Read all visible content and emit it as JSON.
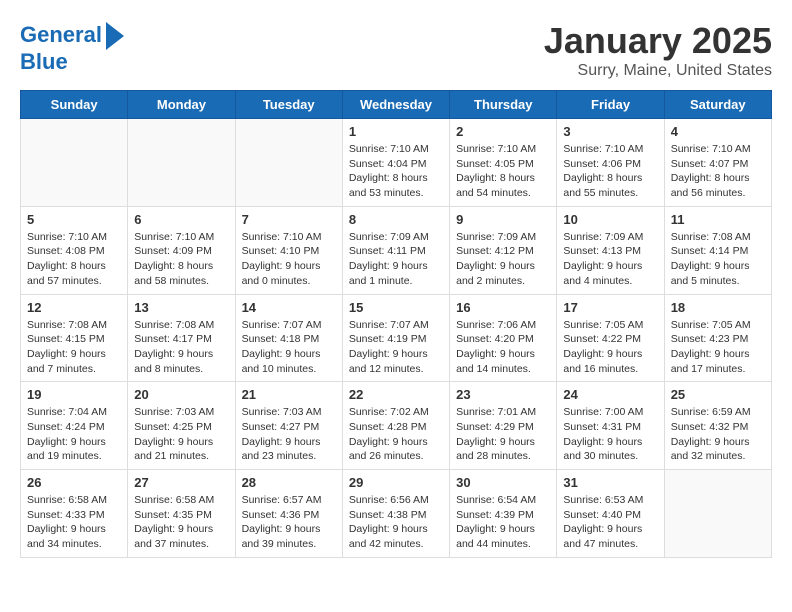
{
  "logo": {
    "line1": "General",
    "line2": "Blue"
  },
  "title": "January 2025",
  "subtitle": "Surry, Maine, United States",
  "weekdays": [
    "Sunday",
    "Monday",
    "Tuesday",
    "Wednesday",
    "Thursday",
    "Friday",
    "Saturday"
  ],
  "weeks": [
    [
      {
        "day": "",
        "detail": ""
      },
      {
        "day": "",
        "detail": ""
      },
      {
        "day": "",
        "detail": ""
      },
      {
        "day": "1",
        "detail": "Sunrise: 7:10 AM\nSunset: 4:04 PM\nDaylight: 8 hours\nand 53 minutes."
      },
      {
        "day": "2",
        "detail": "Sunrise: 7:10 AM\nSunset: 4:05 PM\nDaylight: 8 hours\nand 54 minutes."
      },
      {
        "day": "3",
        "detail": "Sunrise: 7:10 AM\nSunset: 4:06 PM\nDaylight: 8 hours\nand 55 minutes."
      },
      {
        "day": "4",
        "detail": "Sunrise: 7:10 AM\nSunset: 4:07 PM\nDaylight: 8 hours\nand 56 minutes."
      }
    ],
    [
      {
        "day": "5",
        "detail": "Sunrise: 7:10 AM\nSunset: 4:08 PM\nDaylight: 8 hours\nand 57 minutes."
      },
      {
        "day": "6",
        "detail": "Sunrise: 7:10 AM\nSunset: 4:09 PM\nDaylight: 8 hours\nand 58 minutes."
      },
      {
        "day": "7",
        "detail": "Sunrise: 7:10 AM\nSunset: 4:10 PM\nDaylight: 9 hours\nand 0 minutes."
      },
      {
        "day": "8",
        "detail": "Sunrise: 7:09 AM\nSunset: 4:11 PM\nDaylight: 9 hours\nand 1 minute."
      },
      {
        "day": "9",
        "detail": "Sunrise: 7:09 AM\nSunset: 4:12 PM\nDaylight: 9 hours\nand 2 minutes."
      },
      {
        "day": "10",
        "detail": "Sunrise: 7:09 AM\nSunset: 4:13 PM\nDaylight: 9 hours\nand 4 minutes."
      },
      {
        "day": "11",
        "detail": "Sunrise: 7:08 AM\nSunset: 4:14 PM\nDaylight: 9 hours\nand 5 minutes."
      }
    ],
    [
      {
        "day": "12",
        "detail": "Sunrise: 7:08 AM\nSunset: 4:15 PM\nDaylight: 9 hours\nand 7 minutes."
      },
      {
        "day": "13",
        "detail": "Sunrise: 7:08 AM\nSunset: 4:17 PM\nDaylight: 9 hours\nand 8 minutes."
      },
      {
        "day": "14",
        "detail": "Sunrise: 7:07 AM\nSunset: 4:18 PM\nDaylight: 9 hours\nand 10 minutes."
      },
      {
        "day": "15",
        "detail": "Sunrise: 7:07 AM\nSunset: 4:19 PM\nDaylight: 9 hours\nand 12 minutes."
      },
      {
        "day": "16",
        "detail": "Sunrise: 7:06 AM\nSunset: 4:20 PM\nDaylight: 9 hours\nand 14 minutes."
      },
      {
        "day": "17",
        "detail": "Sunrise: 7:05 AM\nSunset: 4:22 PM\nDaylight: 9 hours\nand 16 minutes."
      },
      {
        "day": "18",
        "detail": "Sunrise: 7:05 AM\nSunset: 4:23 PM\nDaylight: 9 hours\nand 17 minutes."
      }
    ],
    [
      {
        "day": "19",
        "detail": "Sunrise: 7:04 AM\nSunset: 4:24 PM\nDaylight: 9 hours\nand 19 minutes."
      },
      {
        "day": "20",
        "detail": "Sunrise: 7:03 AM\nSunset: 4:25 PM\nDaylight: 9 hours\nand 21 minutes."
      },
      {
        "day": "21",
        "detail": "Sunrise: 7:03 AM\nSunset: 4:27 PM\nDaylight: 9 hours\nand 23 minutes."
      },
      {
        "day": "22",
        "detail": "Sunrise: 7:02 AM\nSunset: 4:28 PM\nDaylight: 9 hours\nand 26 minutes."
      },
      {
        "day": "23",
        "detail": "Sunrise: 7:01 AM\nSunset: 4:29 PM\nDaylight: 9 hours\nand 28 minutes."
      },
      {
        "day": "24",
        "detail": "Sunrise: 7:00 AM\nSunset: 4:31 PM\nDaylight: 9 hours\nand 30 minutes."
      },
      {
        "day": "25",
        "detail": "Sunrise: 6:59 AM\nSunset: 4:32 PM\nDaylight: 9 hours\nand 32 minutes."
      }
    ],
    [
      {
        "day": "26",
        "detail": "Sunrise: 6:58 AM\nSunset: 4:33 PM\nDaylight: 9 hours\nand 34 minutes."
      },
      {
        "day": "27",
        "detail": "Sunrise: 6:58 AM\nSunset: 4:35 PM\nDaylight: 9 hours\nand 37 minutes."
      },
      {
        "day": "28",
        "detail": "Sunrise: 6:57 AM\nSunset: 4:36 PM\nDaylight: 9 hours\nand 39 minutes."
      },
      {
        "day": "29",
        "detail": "Sunrise: 6:56 AM\nSunset: 4:38 PM\nDaylight: 9 hours\nand 42 minutes."
      },
      {
        "day": "30",
        "detail": "Sunrise: 6:54 AM\nSunset: 4:39 PM\nDaylight: 9 hours\nand 44 minutes."
      },
      {
        "day": "31",
        "detail": "Sunrise: 6:53 AM\nSunset: 4:40 PM\nDaylight: 9 hours\nand 47 minutes."
      },
      {
        "day": "",
        "detail": ""
      }
    ]
  ]
}
